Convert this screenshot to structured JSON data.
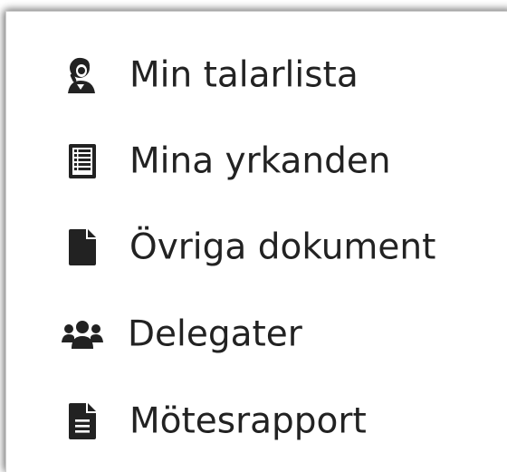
{
  "menu": {
    "items": [
      {
        "label": "Min talarlista",
        "icon": "speaker-list-icon"
      },
      {
        "label": "Mina yrkanden",
        "icon": "list-document-icon"
      },
      {
        "label": "Övriga dokument",
        "icon": "file-icon"
      },
      {
        "label": "Delegater",
        "icon": "users-group-icon"
      },
      {
        "label": "Mötesrapport",
        "icon": "file-text-icon"
      }
    ]
  },
  "colors": {
    "icon": "#222222",
    "text": "#222222",
    "background": "#ffffff"
  }
}
